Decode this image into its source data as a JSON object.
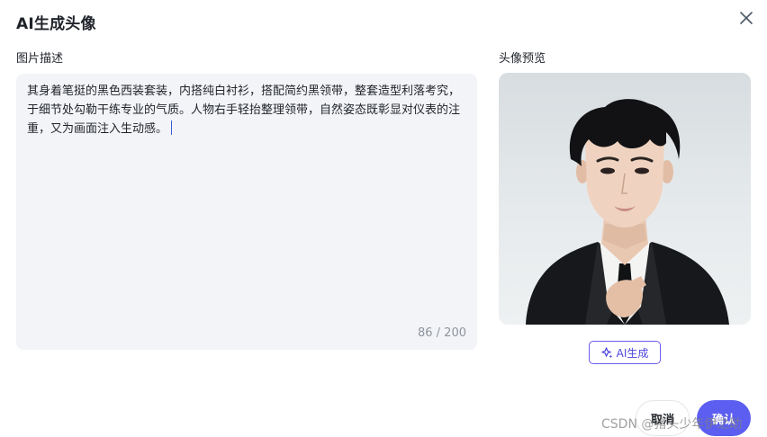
{
  "dialog": {
    "title": "AI生成头像",
    "close_icon": "close-icon"
  },
  "description": {
    "label": "图片描述",
    "text": "其身着笔挺的黑色西装套装，内搭纯白衬衫，搭配简约黑领带，整套造型利落考究，于细节处勾勒干练专业的气质。人物右手轻抬整理领带，自然姿态既彰显对仪表的注重，又为画面注入生动感。",
    "counter": "86 / 200",
    "max_length": 200
  },
  "preview": {
    "label": "头像预览",
    "image": "avatar-portrait"
  },
  "ai_generate": {
    "label": "AI生成",
    "icon": "sparkle-icon",
    "accent": "#5b4ee6"
  },
  "footer": {
    "cancel_label": "取消",
    "confirm_label": "确认",
    "confirm_color": "#5b5ef0"
  },
  "watermark": "CSDN @猪头少年伊之助"
}
